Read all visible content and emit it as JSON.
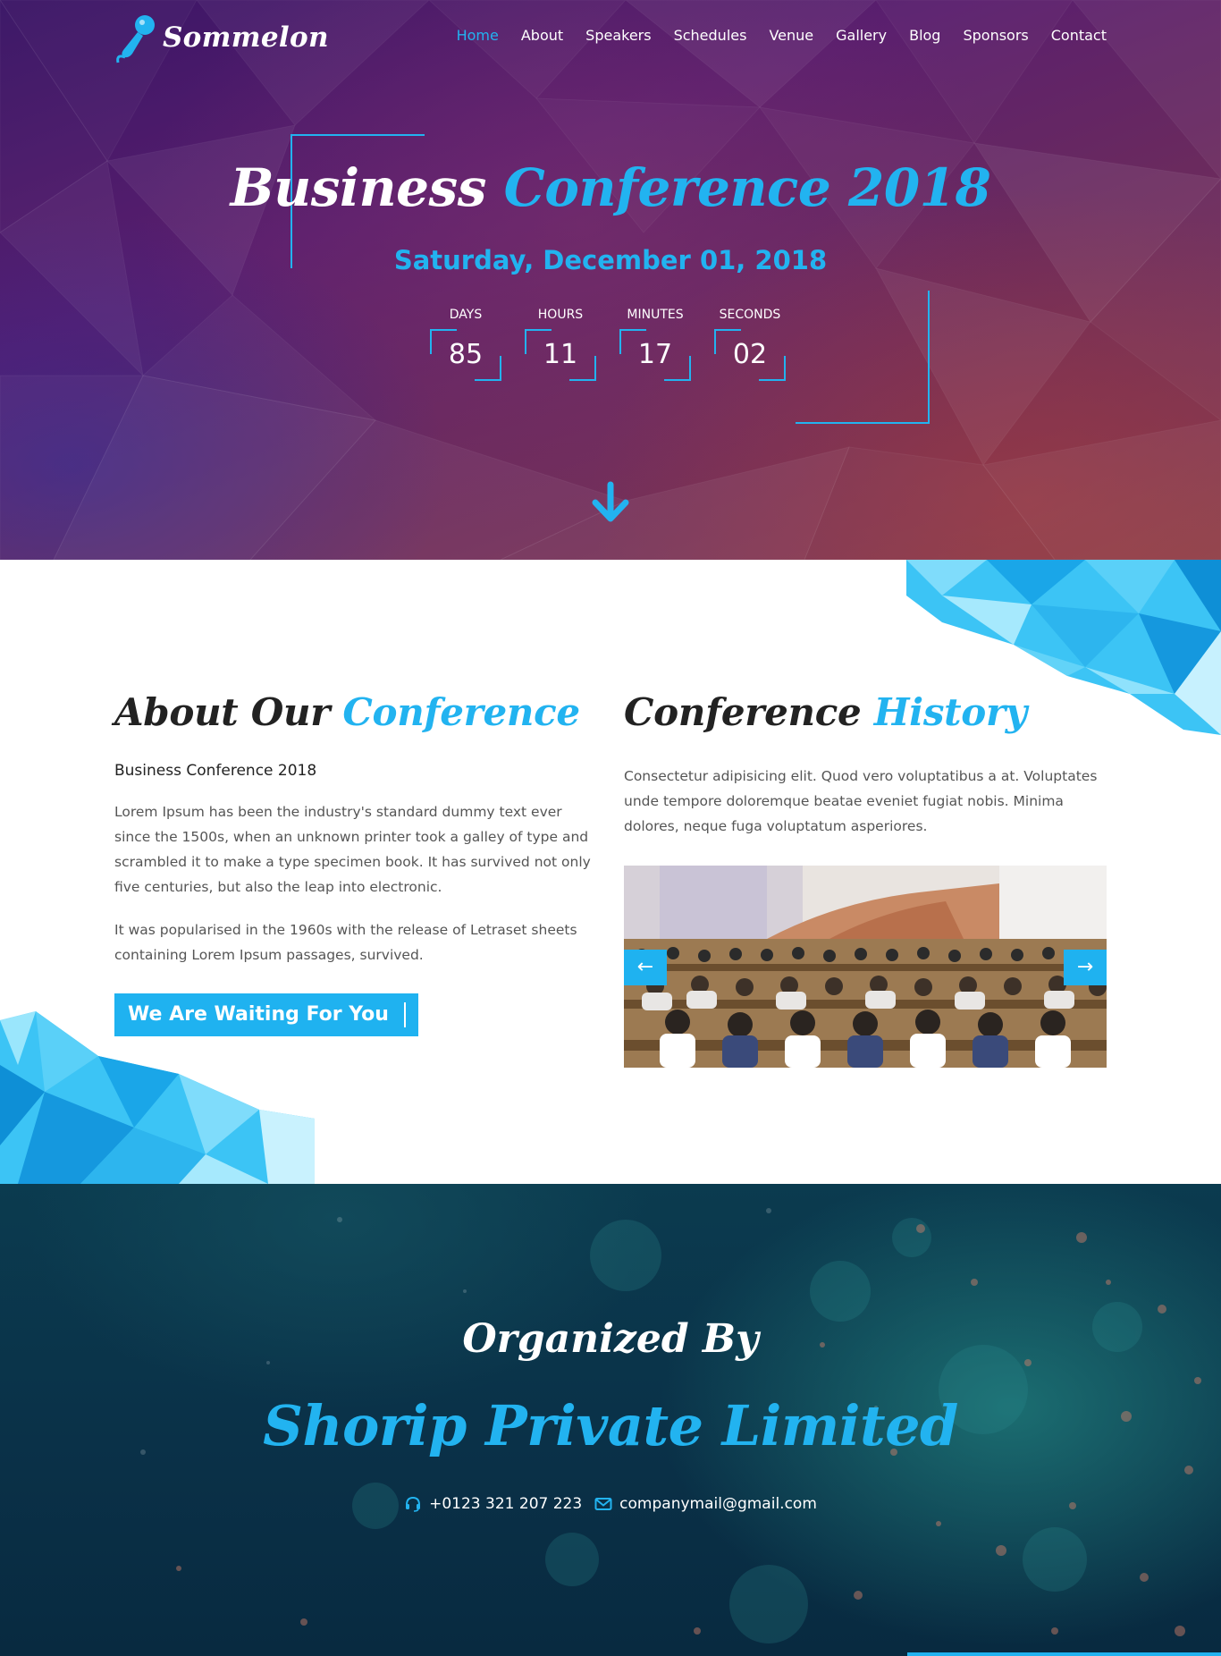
{
  "brand": {
    "name": "Sommelon",
    "accent_color": "#22b3f0",
    "icon": "microphone-icon"
  },
  "nav": {
    "items": [
      {
        "label": "Home",
        "active": true
      },
      {
        "label": "About"
      },
      {
        "label": "Speakers"
      },
      {
        "label": "Schedules"
      },
      {
        "label": "Venue"
      },
      {
        "label": "Gallery"
      },
      {
        "label": "Blog"
      },
      {
        "label": "Sponsors"
      },
      {
        "label": "Contact"
      }
    ]
  },
  "hero": {
    "title_main": "Business",
    "title_accent": "Conference 2018",
    "date": "Saturday, December 01, 2018",
    "countdown": [
      {
        "label": "DAYS",
        "value": "85"
      },
      {
        "label": "HOURS",
        "value": "11"
      },
      {
        "label": "MINUTES",
        "value": "17"
      },
      {
        "label": "SECONDS",
        "value": "02"
      }
    ],
    "scroll_icon": "arrow-down-icon"
  },
  "about": {
    "title_main": "About Our",
    "title_accent": "Conference",
    "subtitle": "Business Conference 2018",
    "paragraph_1": "Lorem Ipsum has been the industry's standard dummy text ever since the 1500s, when an unknown printer took a galley of type and scrambled it to make a type specimen book. It has survived not only five centuries, but also the leap into electronic.",
    "paragraph_2": "It was popularised in the 1960s with the release of Letraset sheets containing Lorem Ipsum passages, survived.",
    "cta_label": "We Are Waiting For You"
  },
  "history": {
    "title_main": "Conference",
    "title_accent": "History",
    "paragraph": "Consectetur adipisicing elit. Quod vero voluptatibus a at. Voluptates unde tempore doloremque beatae eveniet fugiat nobis. Minima dolores, neque fuga voluptatum asperiores.",
    "slider": {
      "prev_icon": "arrow-left-icon",
      "next_icon": "arrow-right-icon"
    }
  },
  "organizer": {
    "title": "Organized By",
    "name": "Shorip Private Limited",
    "phone": "+0123 321 207 223",
    "email": "companymail@gmail.com",
    "phone_icon": "headset-icon",
    "email_icon": "envelope-icon"
  }
}
